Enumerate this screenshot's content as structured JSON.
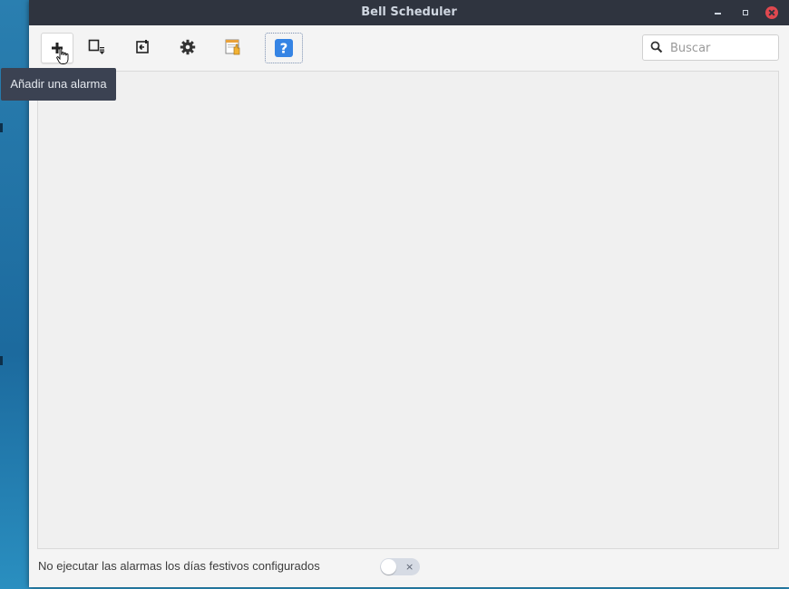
{
  "window": {
    "title": "Bell Scheduler"
  },
  "toolbar": {
    "buttons": [
      {
        "id": "add",
        "icon": "plus-icon",
        "tooltip": "Añadir una alarma"
      },
      {
        "id": "export",
        "icon": "export-icon"
      },
      {
        "id": "import",
        "icon": "import-icon"
      },
      {
        "id": "settings",
        "icon": "gear-icon"
      },
      {
        "id": "holidays",
        "icon": "holiday-calendar-icon"
      },
      {
        "id": "help",
        "icon": "help-icon",
        "glyph": "?"
      }
    ]
  },
  "tooltip": {
    "text": "Añadir una alarma"
  },
  "search": {
    "placeholder": "Buscar",
    "value": ""
  },
  "footer": {
    "holiday_label": "No ejecutar las alarmas los días festivos configurados",
    "toggle_on": false,
    "toggle_off_glyph": "×"
  },
  "colors": {
    "titlebar": "#2f343f",
    "accent": "#3584e4",
    "close": "#e0484f"
  }
}
